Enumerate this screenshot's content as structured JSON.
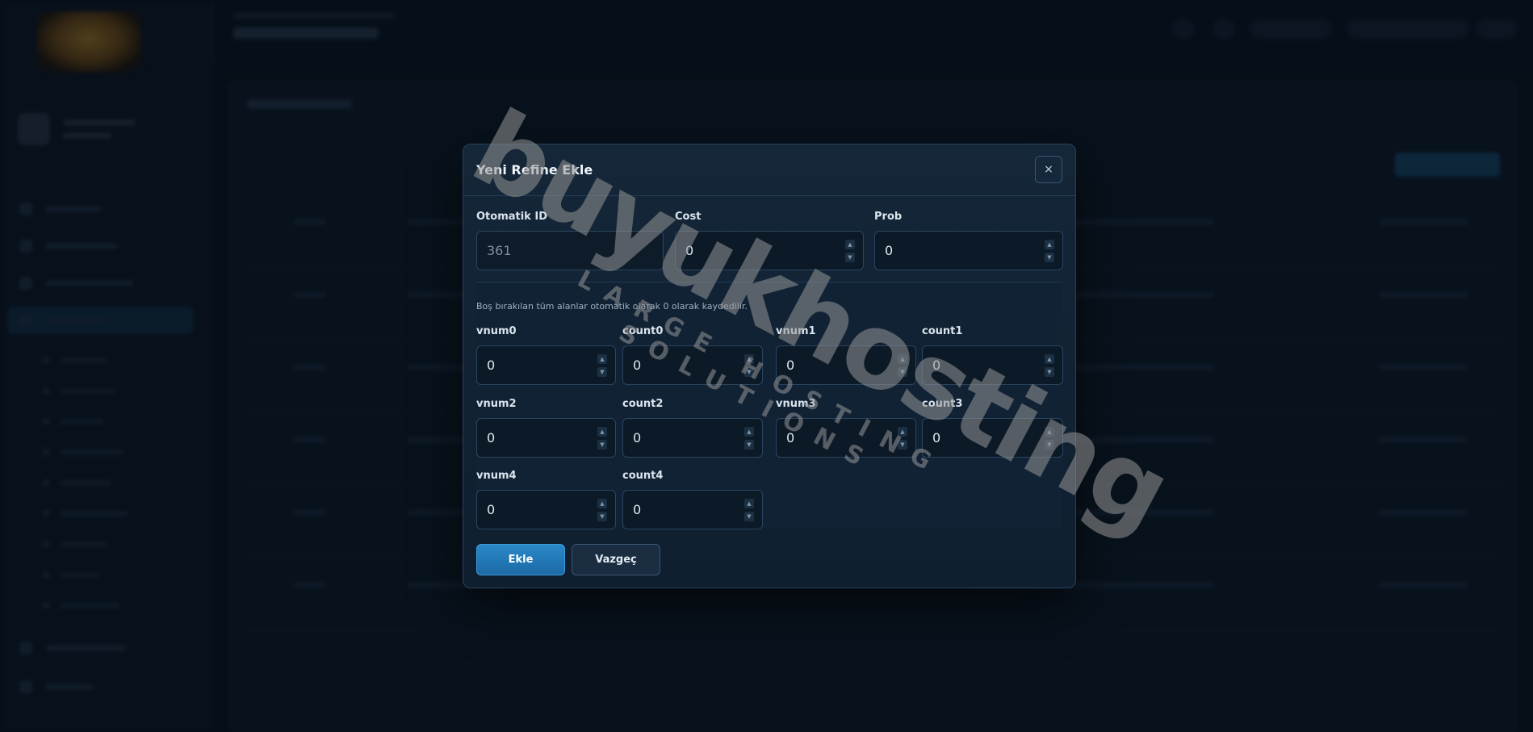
{
  "modal": {
    "title": "Yeni Refine Ekle",
    "close_label": "×",
    "fields_top": [
      {
        "label": "Otomatik ID",
        "value": "361"
      },
      {
        "label": "Cost",
        "value": "0"
      },
      {
        "label": "Prob",
        "value": "0"
      }
    ],
    "hint": "Boş bırakılan tüm alanlar otomatik olarak 0 olarak kaydedilir.",
    "fields_grid": [
      {
        "label": "vnum0",
        "value": "0"
      },
      {
        "label": "count0",
        "value": "0"
      },
      {
        "label": "vnum1",
        "value": "0"
      },
      {
        "label": "count1",
        "value": "0"
      },
      {
        "label": "vnum2",
        "value": "0"
      },
      {
        "label": "count2",
        "value": "0"
      },
      {
        "label": "vnum3",
        "value": "0"
      },
      {
        "label": "count3",
        "value": "0"
      },
      {
        "label": "vnum4",
        "value": "0"
      },
      {
        "label": "count4",
        "value": "0"
      }
    ],
    "submit_label": "Ekle",
    "cancel_label": "Vazgeç"
  },
  "watermark": {
    "main": "buyukhosting",
    "sub": "LARGE HOSTING SOLUTIONS"
  },
  "colors": {
    "background": "#0a1420",
    "modal": "#142638",
    "primary_button": "#2a88c8",
    "secondary_button": "#1b2d40"
  }
}
